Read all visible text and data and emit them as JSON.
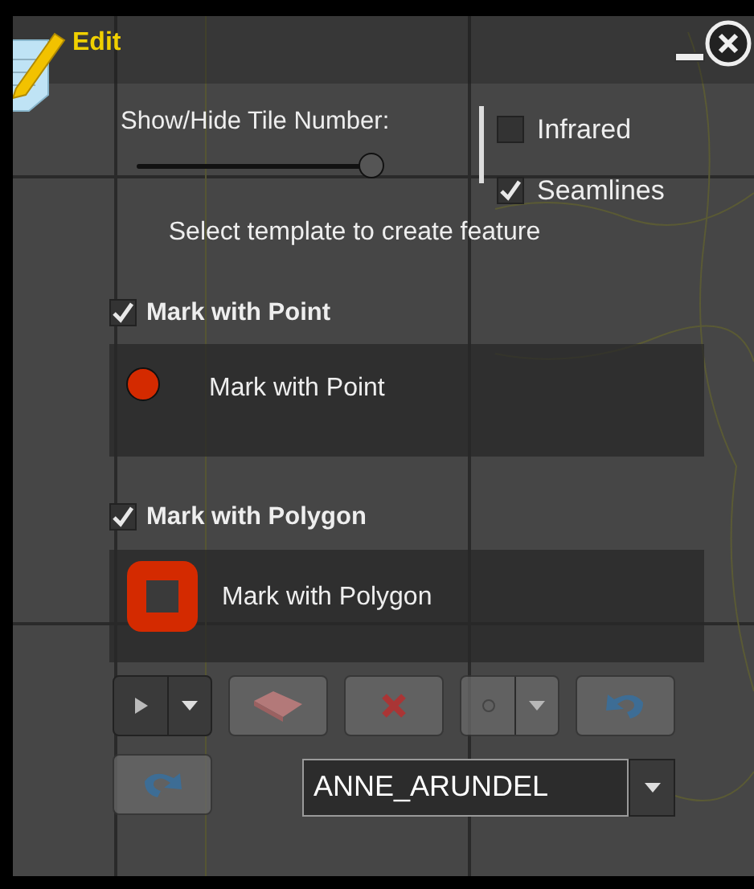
{
  "window": {
    "title": "Edit"
  },
  "tile_number": {
    "label": "Show/Hide Tile Number:",
    "level": 0.97
  },
  "layers": [
    {
      "label": "Infrared",
      "checked": false
    },
    {
      "label": "Seamlines",
      "checked": true
    }
  ],
  "instruction": "Select template to create feature",
  "template_groups": [
    {
      "label": "Mark with Point",
      "checked": true,
      "templates": [
        {
          "label": "Mark with Point",
          "kind": "point"
        }
      ]
    },
    {
      "label": "Mark with Polygon",
      "checked": true,
      "templates": [
        {
          "label": "Mark with Polygon",
          "kind": "polygon"
        }
      ]
    }
  ],
  "tools": [
    {
      "kind": "select",
      "disabled": false
    },
    {
      "kind": "eraser",
      "disabled": true
    },
    {
      "kind": "delete",
      "disabled": true
    },
    {
      "kind": "point",
      "disabled": true
    },
    {
      "kind": "undo",
      "disabled": true
    },
    {
      "kind": "redo",
      "disabled": true
    }
  ],
  "county": {
    "value": "ANNE_ARUNDEL"
  }
}
